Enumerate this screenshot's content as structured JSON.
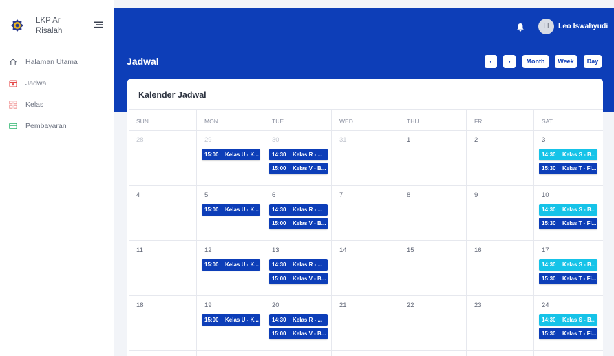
{
  "brand": {
    "name": "LKP Ar Risalah"
  },
  "sidebar": {
    "items": [
      {
        "label": "Halaman Utama",
        "icon": "home-icon"
      },
      {
        "label": "Jadwal",
        "icon": "calendar-icon"
      },
      {
        "label": "Kelas",
        "icon": "classes-icon"
      },
      {
        "label": "Pembayaran",
        "icon": "payment-icon"
      }
    ]
  },
  "header": {
    "user_initials": "LI",
    "user_name": "Leo Iswahyudi",
    "page_title": "Jadwal",
    "prev_label": "‹",
    "next_label": "›",
    "month_label": "Month",
    "week_label": "Week",
    "day_label": "Day"
  },
  "calendar": {
    "title": "Kalender Jadwal",
    "weekdays": [
      "SUN",
      "MON",
      "TUE",
      "WED",
      "THU",
      "FRI",
      "SAT"
    ],
    "weeks": [
      {
        "days": [
          {
            "num": "28",
            "other": true,
            "events": []
          },
          {
            "num": "29",
            "other": true,
            "events": [
              {
                "time": "15:00",
                "title": "Kelas U - K..."
              }
            ]
          },
          {
            "num": "30",
            "other": true,
            "events": [
              {
                "time": "14:30",
                "title": "Kelas R - ..."
              },
              {
                "time": "15:00",
                "title": "Kelas V - B..."
              }
            ]
          },
          {
            "num": "31",
            "other": true,
            "events": []
          },
          {
            "num": "1",
            "events": []
          },
          {
            "num": "2",
            "events": []
          },
          {
            "num": "3",
            "events": [
              {
                "time": "14:30",
                "title": "Kelas S - B...",
                "color": "#16c3e8"
              },
              {
                "time": "15:30",
                "title": "Kelas T - Fi..."
              }
            ]
          }
        ]
      },
      {
        "days": [
          {
            "num": "4",
            "events": []
          },
          {
            "num": "5",
            "events": [
              {
                "time": "15:00",
                "title": "Kelas U - K..."
              }
            ]
          },
          {
            "num": "6",
            "events": [
              {
                "time": "14:30",
                "title": "Kelas R - ..."
              },
              {
                "time": "15:00",
                "title": "Kelas V - B..."
              }
            ]
          },
          {
            "num": "7",
            "events": []
          },
          {
            "num": "8",
            "events": []
          },
          {
            "num": "9",
            "events": []
          },
          {
            "num": "10",
            "events": [
              {
                "time": "14:30",
                "title": "Kelas S - B...",
                "color": "#16c3e8"
              },
              {
                "time": "15:30",
                "title": "Kelas T - Fi..."
              }
            ]
          }
        ]
      },
      {
        "days": [
          {
            "num": "11",
            "events": []
          },
          {
            "num": "12",
            "events": [
              {
                "time": "15:00",
                "title": "Kelas U - K..."
              }
            ]
          },
          {
            "num": "13",
            "events": [
              {
                "time": "14:30",
                "title": "Kelas R - ..."
              },
              {
                "time": "15:00",
                "title": "Kelas V - B..."
              }
            ]
          },
          {
            "num": "14",
            "events": []
          },
          {
            "num": "15",
            "events": []
          },
          {
            "num": "16",
            "events": []
          },
          {
            "num": "17",
            "events": [
              {
                "time": "14:30",
                "title": "Kelas S - B...",
                "color": "#16c3e8"
              },
              {
                "time": "15:30",
                "title": "Kelas T - Fi..."
              }
            ]
          }
        ]
      },
      {
        "days": [
          {
            "num": "18",
            "events": []
          },
          {
            "num": "19",
            "events": [
              {
                "time": "15:00",
                "title": "Kelas U - K..."
              }
            ]
          },
          {
            "num": "20",
            "events": [
              {
                "time": "14:30",
                "title": "Kelas R - ..."
              },
              {
                "time": "15:00",
                "title": "Kelas V - B..."
              }
            ]
          },
          {
            "num": "21",
            "events": []
          },
          {
            "num": "22",
            "events": []
          },
          {
            "num": "23",
            "events": []
          },
          {
            "num": "24",
            "events": [
              {
                "time": "14:30",
                "title": "Kelas S - B...",
                "color": "#16c3e8"
              },
              {
                "time": "15:30",
                "title": "Kelas T - Fi..."
              }
            ]
          }
        ]
      }
    ]
  },
  "colors": {
    "primary": "#0d3eb8",
    "accent": "#16c3e8",
    "background": "#f2f4f8"
  }
}
